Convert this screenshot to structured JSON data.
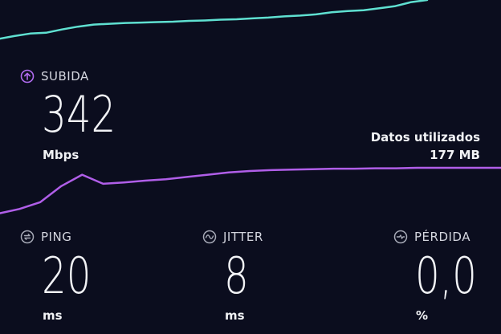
{
  "download_graph": {
    "color": "#5fe0d1",
    "values": [
      0.05,
      0.12,
      0.18,
      0.2,
      0.28,
      0.35,
      0.4,
      0.42,
      0.44,
      0.45,
      0.46,
      0.47,
      0.49,
      0.5,
      0.52,
      0.53,
      0.55,
      0.57,
      0.6,
      0.62,
      0.65,
      0.7,
      0.73,
      0.75,
      0.8,
      0.85,
      0.95,
      1.0
    ]
  },
  "upload": {
    "icon": "arrow-up-circle-icon",
    "icon_color": "#b16cf0",
    "label": "SUBIDA",
    "value": "342",
    "unit": "Mbps"
  },
  "data_used": {
    "label": "Datos utilizados",
    "value": "177 MB"
  },
  "upload_graph": {
    "color": "#b05ee8",
    "values": [
      0.0,
      0.1,
      0.25,
      0.6,
      0.85,
      0.65,
      0.68,
      0.72,
      0.75,
      0.8,
      0.85,
      0.9,
      0.93,
      0.95,
      0.96,
      0.97,
      0.98,
      0.98,
      0.99,
      0.99,
      1.0,
      1.0,
      1.0,
      1.0,
      1.0
    ]
  },
  "metrics": [
    {
      "icon": "ping-icon",
      "label": "PING",
      "value": "20",
      "unit": "ms"
    },
    {
      "icon": "jitter-icon",
      "label": "JITTER",
      "value": "8",
      "unit": "ms"
    },
    {
      "icon": "packet-loss-icon",
      "label": "PÉRDIDA",
      "value": "0,0",
      "unit": "%"
    }
  ]
}
